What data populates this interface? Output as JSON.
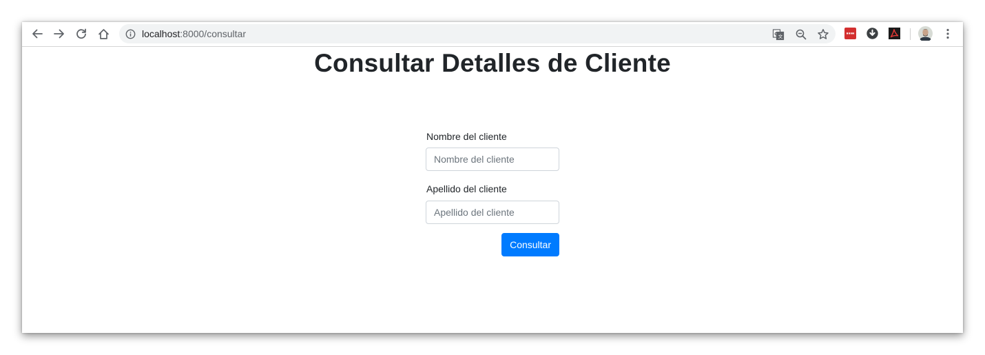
{
  "browser": {
    "url_host": "localhost",
    "url_path": ":8000/consultar",
    "icons": {
      "back": "back-arrow-icon",
      "forward": "forward-arrow-icon",
      "reload": "reload-icon",
      "home": "home-icon",
      "info": "info-icon",
      "translate": "translate-icon",
      "zoom": "zoom-out-icon",
      "bookmark": "star-icon",
      "extension_1": "red-extension-icon",
      "extension_2": "download-icon",
      "extension_3": "pdf-extension-icon",
      "profile": "avatar",
      "menu": "kebab-menu-icon"
    }
  },
  "page": {
    "title": "Consultar Detalles de Cliente",
    "form": {
      "first_name_label": "Nombre del cliente",
      "first_name_placeholder": "Nombre del cliente",
      "first_name_value": "",
      "last_name_label": "Apellido del cliente",
      "last_name_placeholder": "Apellido del cliente",
      "last_name_value": "",
      "submit_label": "Consultar"
    }
  },
  "colors": {
    "primary": "#007bff",
    "text": "#212529",
    "input_border": "#ced4da"
  }
}
